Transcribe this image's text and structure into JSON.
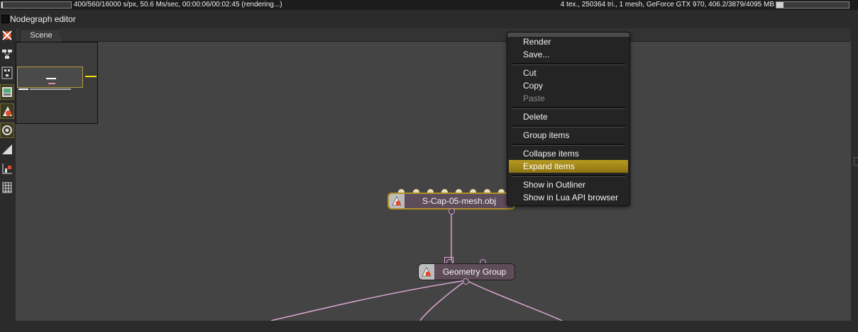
{
  "topbar": {
    "render_progress_fraction": 0.025,
    "render_status": "400/560/16000 s/px, 50.6 Ms/sec, 00:00:06/00:02:45 (rendering...)",
    "gpu_status": "4 tex., 250364 tri., 1 mesh, GeForce GTX 970, 406.2/3879/4095 MB",
    "gpu_mem_fraction": 0.1
  },
  "panel": {
    "title": "Nodegraph editor"
  },
  "tabs": [
    {
      "label": "Scene"
    }
  ],
  "toolbar": {
    "tools": [
      {
        "icon": "render-target-icon",
        "active": false
      },
      {
        "icon": "node-layout-icon",
        "active": false
      },
      {
        "icon": "node-arrange-icon",
        "active": false
      },
      {
        "icon": "scene-image-icon",
        "active": true
      },
      {
        "icon": "mesh-object-icon",
        "active": true
      },
      {
        "icon": "camera-eye-icon",
        "active": true
      },
      {
        "icon": "material-edit-icon",
        "active": false
      },
      {
        "icon": "graph-add-icon",
        "active": false
      },
      {
        "icon": "grid-table-icon",
        "active": false
      }
    ]
  },
  "nodes": {
    "mesh": {
      "label": "S-Cap-05-mesh.obj",
      "icon": "mesh-object-icon"
    },
    "group": {
      "label": "Geometry Group",
      "icon": "geometry-group-icon"
    }
  },
  "context_menu": {
    "items": [
      {
        "label": "Render",
        "enabled": true,
        "highlighted": false
      },
      {
        "label": "Save...",
        "enabled": true,
        "highlighted": false
      },
      {
        "label": "Cut",
        "enabled": true,
        "highlighted": false
      },
      {
        "label": "Copy",
        "enabled": true,
        "highlighted": false
      },
      {
        "label": "Paste",
        "enabled": false,
        "highlighted": false
      },
      {
        "label": "Delete",
        "enabled": true,
        "highlighted": false
      },
      {
        "label": "Group items",
        "enabled": true,
        "highlighted": false
      },
      {
        "label": "Collapse items",
        "enabled": true,
        "highlighted": false
      },
      {
        "label": "Expand items",
        "enabled": true,
        "highlighted": true
      },
      {
        "label": "Show in Outliner",
        "enabled": true,
        "highlighted": false
      },
      {
        "label": "Show in Lua API browser",
        "enabled": true,
        "highlighted": false
      }
    ]
  },
  "colors": {
    "highlight": "#a88a19",
    "node_selected_border": "#b08f2b",
    "wire": "#d6a4cf",
    "pin": "#e9dfb2"
  }
}
